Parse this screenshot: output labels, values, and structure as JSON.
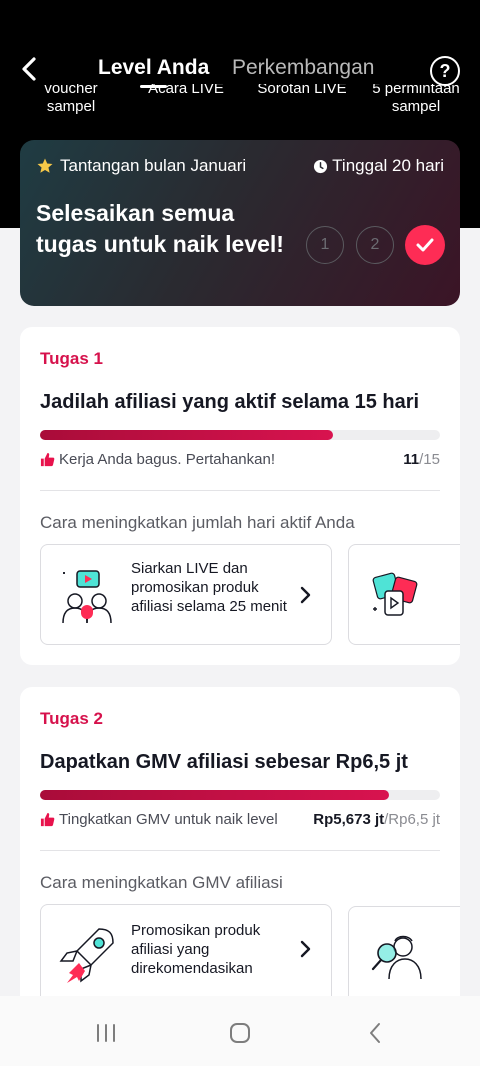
{
  "header": {
    "tab_active": "Level Anda",
    "tab_inactive": "Perkembangan",
    "help_label": "?"
  },
  "rewards": [
    {
      "line1": "voucher",
      "line2": "sampel"
    },
    {
      "line1": "Acara LIVE",
      "line2": ""
    },
    {
      "line1": "Sorotan LIVE",
      "line2": ""
    },
    {
      "line1": "5 permintaan",
      "line2": "sampel"
    }
  ],
  "challenge": {
    "month_label": "Tantangan bulan Januari",
    "remaining": "Tinggal 20 hari",
    "title": "Selesaikan semua tugas untuk naik level!",
    "steps": [
      "1",
      "2"
    ]
  },
  "tasks": [
    {
      "label": "Tugas 1",
      "title": "Jadilah afiliasi yang aktif selama 15 hari",
      "progress": 0.733,
      "note": "Kerja Anda bagus. Pertahankan!",
      "count_current": "11",
      "count_total": "/15",
      "how_label": "Cara meningkatkan jumlah hari aktif Anda",
      "tip_text": "Siarkan LIVE dan promosikan produk afiliasi selama 25 menit"
    },
    {
      "label": "Tugas 2",
      "title": "Dapatkan GMV afiliasi sebesar Rp6,5 jt",
      "progress": 0.873,
      "note": "Tingkatkan GMV untuk naik level",
      "count_current": "Rp5,673 jt",
      "count_total": "/Rp6,5 jt",
      "how_label": "Cara meningkatkan GMV afiliasi",
      "tip_text": "Promosikan produk afiliasi yang direkomendasikan"
    }
  ],
  "colors": {
    "accent": "#fe2c55",
    "task_red": "#d6124c"
  }
}
